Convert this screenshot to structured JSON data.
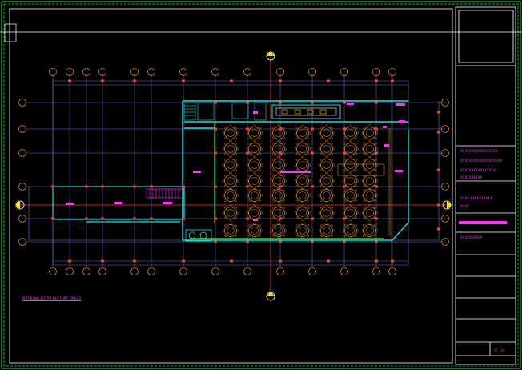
{
  "drawing": {
    "plan_title": "MẶT BẰNG BỐ TRÍ NỘI THẤT TẦNG 2",
    "sheet_number": "KT - 04"
  },
  "title_block": {
    "notes": [
      "XXXXXXXXXXXXXXXXX",
      "XXXXXXXXXXXXXXXXXXX",
      "XXXXXXXXXXXXXXXX",
      "XXXXXXXXXX",
      "XXXX XXXXXXXXXX",
      "XXXX",
      "XXXXXXXXXX"
    ]
  },
  "colors": {
    "background": "#000000",
    "border": "#22dd22",
    "wall": "#22dddd",
    "grid": "#ff3b3b",
    "furniture": "#d4852a",
    "annotation": "#ff33ff",
    "dimension": "#6f6fd8",
    "white": "#ffffff"
  },
  "icons": {
    "north_marker": "section-marker-icon",
    "grid_bubble": "grid-bubble-icon"
  }
}
